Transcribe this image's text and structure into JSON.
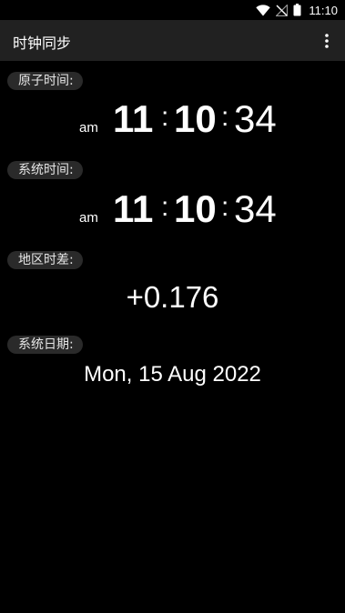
{
  "status_bar": {
    "time": "11:10",
    "icons": [
      "wifi-icon",
      "no-signal-icon",
      "battery-icon"
    ]
  },
  "app_bar": {
    "title": "时钟同步",
    "menu_icon": "overflow-menu-icon"
  },
  "atomic_time": {
    "label": "原子时间:",
    "ampm": "am",
    "hours": "11",
    "minutes": "10",
    "seconds": "34",
    "separator": ":"
  },
  "system_time": {
    "label": "系统时间:",
    "ampm": "am",
    "hours": "11",
    "minutes": "10",
    "seconds": "34",
    "separator": ":"
  },
  "time_offset": {
    "label": "地区时差:",
    "value": "+0.176"
  },
  "system_date": {
    "label": "系统日期:",
    "value": "Mon, 15 Aug 2022"
  },
  "colors": {
    "background": "#000000",
    "app_bar": "#212121",
    "chip": "#2a2a2a",
    "text": "#ffffff"
  }
}
